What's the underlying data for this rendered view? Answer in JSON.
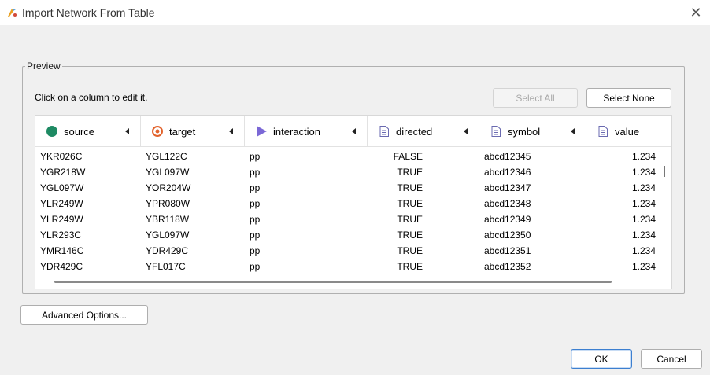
{
  "window": {
    "title": "Import Network From Table"
  },
  "preview": {
    "legend": "Preview",
    "hint": "Click on a column to edit it.",
    "select_all_label": "Select All",
    "select_none_label": "Select None"
  },
  "columns": [
    {
      "name": "source",
      "icon": "source-node-icon"
    },
    {
      "name": "target",
      "icon": "target-node-icon"
    },
    {
      "name": "interaction",
      "icon": "interaction-icon"
    },
    {
      "name": "directed",
      "icon": "attribute-document-icon"
    },
    {
      "name": "symbol",
      "icon": "attribute-document-icon"
    },
    {
      "name": "value",
      "icon": "attribute-document-icon"
    }
  ],
  "rows": [
    [
      "YKR026C",
      "YGL122C",
      "pp",
      "FALSE",
      "abcd12345",
      "1.234"
    ],
    [
      "YGR218W",
      "YGL097W",
      "pp",
      "TRUE",
      "abcd12346",
      "1.234"
    ],
    [
      "YGL097W",
      "YOR204W",
      "pp",
      "TRUE",
      "abcd12347",
      "1.234"
    ],
    [
      "YLR249W",
      "YPR080W",
      "pp",
      "TRUE",
      "abcd12348",
      "1.234"
    ],
    [
      "YLR249W",
      "YBR118W",
      "pp",
      "TRUE",
      "abcd12349",
      "1.234"
    ],
    [
      "YLR293C",
      "YGL097W",
      "pp",
      "TRUE",
      "abcd12350",
      "1.234"
    ],
    [
      "YMR146C",
      "YDR429C",
      "pp",
      "TRUE",
      "abcd12351",
      "1.234"
    ],
    [
      "YDR429C",
      "YFL017C",
      "pp",
      "TRUE",
      "abcd12352",
      "1.234"
    ]
  ],
  "buttons": {
    "advanced_options_label": "Advanced Options...",
    "ok_label": "OK",
    "cancel_label": "Cancel"
  },
  "colors": {
    "source_icon": "#1e8a63",
    "target_icon": "#e2622b",
    "interaction_icon": "#7b68d6",
    "ok_border": "#3c7fd0"
  }
}
